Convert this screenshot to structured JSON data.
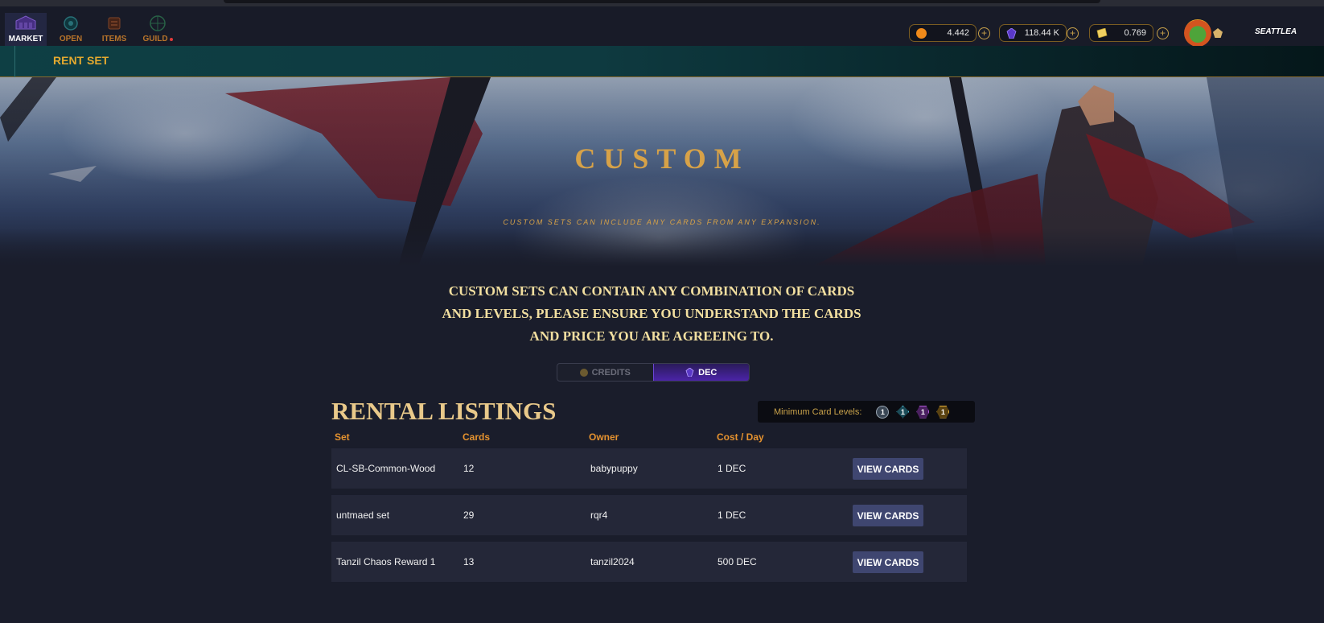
{
  "nav": {
    "items": [
      {
        "label": "MARKET",
        "active": true
      },
      {
        "label": "OPEN",
        "active": false
      },
      {
        "label": "ITEMS",
        "active": false
      },
      {
        "label": "GUILD",
        "active": false,
        "has_notification": true
      }
    ]
  },
  "wallet": {
    "credits": "4.442",
    "dec": "118.44 K",
    "voucher": "0.769"
  },
  "user": {
    "name": "SEATTLEA"
  },
  "section_bar": {
    "title": "RENT SET"
  },
  "hero": {
    "title": "CUSTOM",
    "subtitle": "CUSTOM SETS CAN INCLUDE ANY CARDS FROM ANY EXPANSION."
  },
  "notice": {
    "line1": "CUSTOM SETS CAN CONTAIN ANY COMBINATION OF CARDS",
    "line2": "AND LEVELS, PLEASE ENSURE YOU UNDERSTAND THE CARDS",
    "line3": "AND PRICE YOU ARE AGREEING TO."
  },
  "currency_toggle": {
    "options": [
      "CREDITS",
      "DEC"
    ],
    "selected": "DEC"
  },
  "listings": {
    "title": "RENTAL LISTINGS",
    "min_levels_label": "Minimum Card Levels:",
    "min_levels": [
      "1",
      "1",
      "1",
      "1"
    ],
    "columns": [
      "Set",
      "Cards",
      "Owner",
      "Cost / Day"
    ],
    "action_label": "VIEW CARDS",
    "rows": [
      {
        "set": "CL-SB-Common-Wood",
        "cards": "12",
        "owner": "babypuppy",
        "cost": "1 DEC"
      },
      {
        "set": "untmaed set",
        "cards": "29",
        "owner": "rqr4",
        "cost": "1 DEC"
      },
      {
        "set": "Tanzil Chaos Reward 1",
        "cards": "13",
        "owner": "tanzil2024",
        "cost": "500 DEC"
      }
    ]
  },
  "colors": {
    "accent_gold": "#d7a248",
    "nav_orange": "#b8742a",
    "dec_purple": "#4b24a8",
    "button_blue": "#3f4670"
  },
  "icons": {
    "market": "market-icon",
    "open": "open-pack-icon",
    "items": "items-icon",
    "guild": "guild-icon",
    "credits": "credits-coin-icon",
    "dec": "dec-gem-icon",
    "voucher": "voucher-icon"
  }
}
